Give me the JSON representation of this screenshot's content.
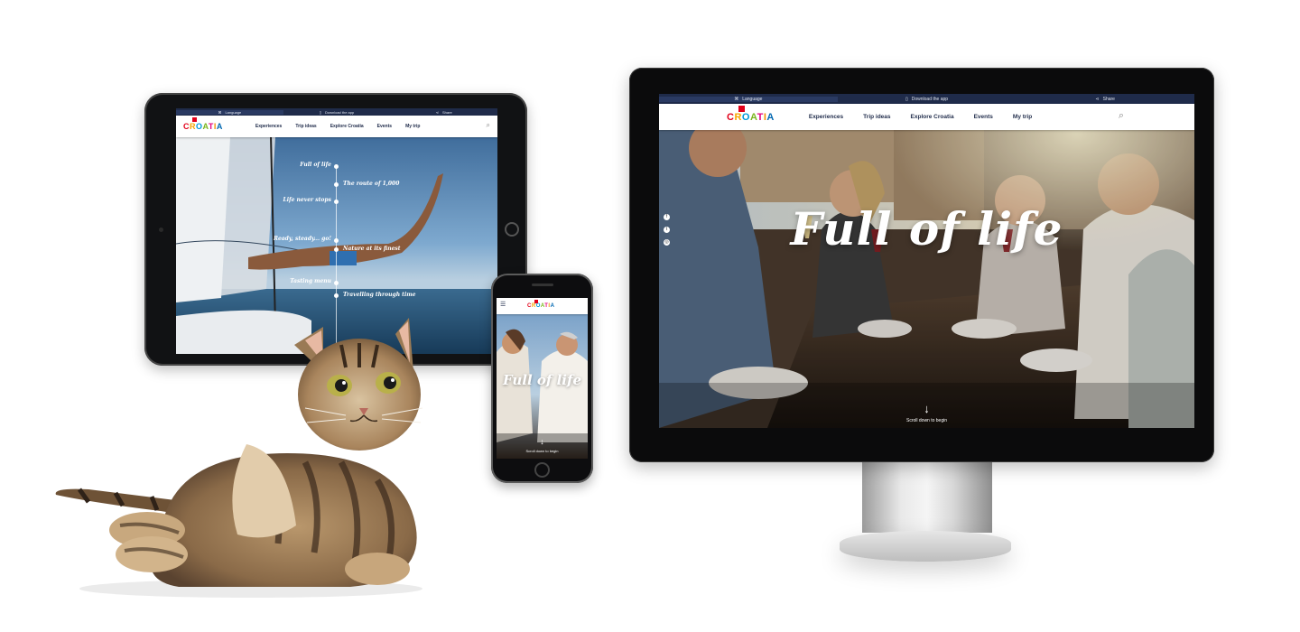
{
  "topbar": {
    "language": "Language",
    "download": "Download the app",
    "share": "Share"
  },
  "logo": {
    "letters": [
      "C",
      "R",
      "O",
      "A",
      "T",
      "I",
      "A"
    ]
  },
  "nav": {
    "items": [
      "Experiences",
      "Trip ideas",
      "Explore Croatia",
      "Events",
      "My trip"
    ]
  },
  "desktop": {
    "headline": "Full of life",
    "scroll_hint": "Scroll down to begin",
    "social": [
      "facebook-icon",
      "twitter-icon",
      "instagram-icon"
    ]
  },
  "tablet": {
    "timeline": [
      {
        "label": "Full of life",
        "side": "left"
      },
      {
        "label": "The route of 1,000",
        "side": "right"
      },
      {
        "label": "Life never stops",
        "side": "left"
      },
      {
        "label": "Ready, steady... go!",
        "side": "left"
      },
      {
        "label": "Nature at its finest",
        "side": "right"
      },
      {
        "label": "Tasting menu",
        "side": "left"
      },
      {
        "label": "Travelling through time",
        "side": "right"
      }
    ]
  },
  "mobile": {
    "headline": "Full of life",
    "scroll_hint": "Scroll down to begin"
  },
  "colors": {
    "navy": "#1f2b4a",
    "logo_red": "#e2001a",
    "logo_orange": "#f7a600",
    "logo_blue": "#0098d8",
    "logo_green": "#7ab51d"
  }
}
